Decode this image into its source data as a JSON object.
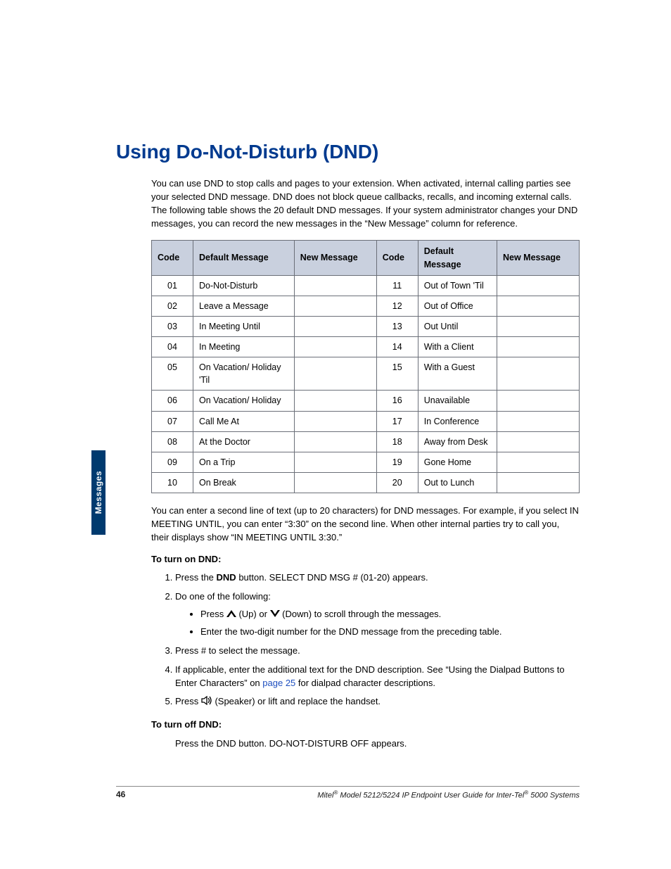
{
  "sidebar_tab": "Messages",
  "title": "Using Do-Not-Disturb (DND)",
  "intro": "You can use DND to stop calls and pages to your extension. When activated, internal calling parties see your selected DND message. DND does not block queue callbacks, recalls, and incoming external calls. The following table shows the 20 default DND messages. If your system administrator changes your DND messages, you can record the new messages in the “New Message” column for reference.",
  "table": {
    "headers": {
      "code": "Code",
      "default_message": "Default Message",
      "new_message": "New Message"
    },
    "rows": [
      {
        "c1": "01",
        "m1": "Do-Not-Disturb",
        "c2": "11",
        "m2": "Out of Town 'Til"
      },
      {
        "c1": "02",
        "m1": "Leave a Message",
        "c2": "12",
        "m2": "Out of Office"
      },
      {
        "c1": "03",
        "m1": "In Meeting Until",
        "c2": "13",
        "m2": "Out Until"
      },
      {
        "c1": "04",
        "m1": "In Meeting",
        "c2": "14",
        "m2": "With a Client"
      },
      {
        "c1": "05",
        "m1": "On Vacation/ Holiday 'Til",
        "c2": "15",
        "m2": "With a Guest"
      },
      {
        "c1": "06",
        "m1": "On Vacation/ Holiday",
        "c2": "16",
        "m2": "Unavailable"
      },
      {
        "c1": "07",
        "m1": "Call Me At",
        "c2": "17",
        "m2": "In Conference"
      },
      {
        "c1": "08",
        "m1": "At the Doctor",
        "c2": "18",
        "m2": "Away from Desk"
      },
      {
        "c1": "09",
        "m1": "On a Trip",
        "c2": "19",
        "m2": "Gone Home"
      },
      {
        "c1": "10",
        "m1": "On Break",
        "c2": "20",
        "m2": "Out to Lunch"
      }
    ]
  },
  "para_secondline": "You can enter a second line of text (up to 20 characters) for DND messages. For example, if you select IN MEETING UNTIL, you can enter “3:30” on the second line. When other internal parties try to call you, their displays show “IN MEETING UNTIL 3:30.”",
  "turn_on_head": "To turn on DND:",
  "steps_on": {
    "s1_a": "Press the ",
    "s1_b": "DND",
    "s1_c": " button. SELECT DND MSG # (01-20) appears.",
    "s2": "Do one of the following:",
    "b1_a": "Press ",
    "b1_up": " (Up) or ",
    "b1_down": " (Down) to scroll through the messages.",
    "b2": "Enter the two-digit number for the DND message from the preceding table.",
    "s3": "Press # to select the message.",
    "s4_a": "If applicable",
    "s4_b": ", enter the additional text for the DND description. See “Using the Dialpad Buttons to Enter Characters” on ",
    "s4_link": "page 25",
    "s4_c": " for dialpad character descriptions.",
    "s5_a": "Press ",
    "s5_b": " (Speaker) or lift and replace the handset."
  },
  "turn_off_head": "To turn off DND:",
  "turn_off_body": "Press the DND button. DO-NOT-DISTURB OFF appears.",
  "footer": {
    "page_num": "46",
    "text_a": "Mitel",
    "text_b": " Model 5212/5224 IP Endpoint User Guide for Inter-Tel",
    "text_c": " 5000 Systems",
    "reg": "®"
  }
}
